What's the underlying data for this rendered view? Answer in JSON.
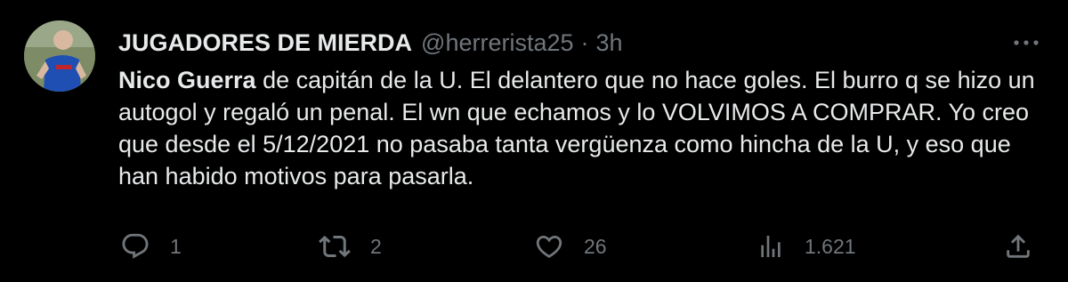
{
  "tweet": {
    "author_name": "JUGADORES DE MIERDA",
    "handle": "@herrerista25",
    "separator": "·",
    "time": "3h",
    "mention": "Nico Guerra",
    "text": " de capitán de la U. El delantero que no hace goles. El burro q se hizo un autogol y regaló un penal. El wn que echamos y lo VOLVIMOS A COMPRAR. Yo creo que desde el 5/12/2021 no pasaba tanta vergüenza como hincha de la U, y eso que han habido motivos para pasarla."
  },
  "actions": {
    "replies": "1",
    "retweets": "2",
    "likes": "26",
    "views": "1.621"
  },
  "icons": [
    "more-icon",
    "reply-icon",
    "retweet-icon",
    "like-icon",
    "views-icon",
    "share-icon"
  ],
  "colors": {
    "background": "#000000",
    "text": "#e7e9ea",
    "secondary": "#71767b"
  }
}
